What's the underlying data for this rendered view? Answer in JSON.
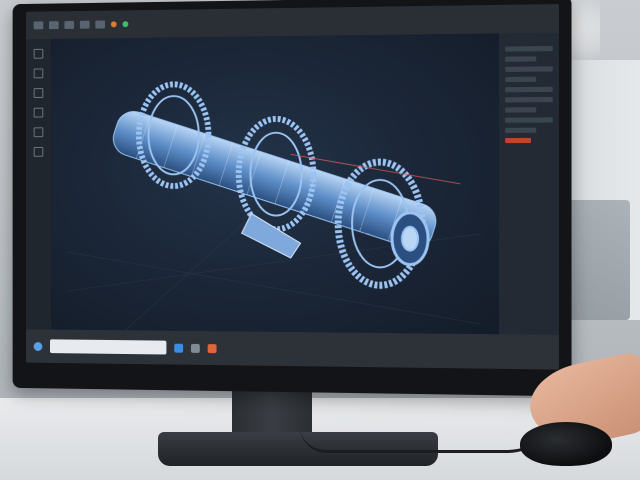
{
  "scene": {
    "description_kind": "photo",
    "colors": {
      "accent": "#3c7bd6",
      "wireframe": "#9cc4f2",
      "viewport_bg": "#1a2536"
    }
  },
  "cad_app": {
    "toolbar_icons": [
      "tool-icon",
      "tool-icon",
      "tool-icon",
      "tool-icon",
      "tool-icon",
      "tool-icon"
    ],
    "status_icons": [
      "orange-status-icon",
      "green-status-icon"
    ],
    "model": "mechanical-shaft-assembly-wireframe"
  },
  "taskbar": {
    "icons": [
      "search-icon",
      "app-icon",
      "app-icon",
      "app-icon"
    ]
  }
}
